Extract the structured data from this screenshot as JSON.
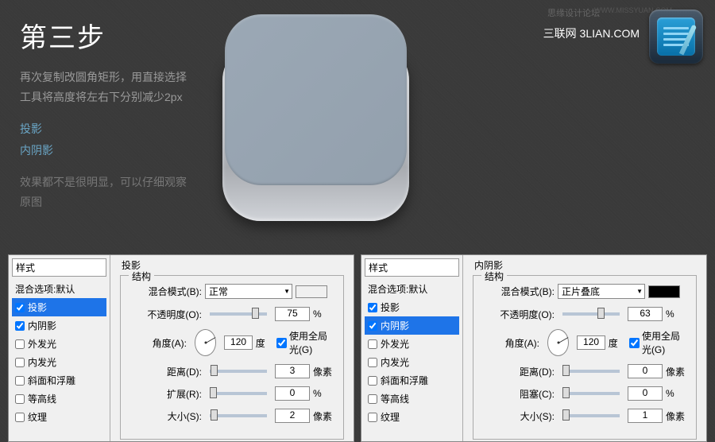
{
  "watermarks": {
    "forum": "思缘设计论坛",
    "url": "WWW.MISSYUAN.COM"
  },
  "brand": "三联网 3LIAN.COM",
  "tutorial": {
    "title": "第三步",
    "description": "再次复制改圆角矩形，用直接选择工具将高度将左右下分别减少2px",
    "links": {
      "drop_shadow": "投影",
      "inner_shadow": "内阴影"
    },
    "note": "效果都不是很明显，可以仔细观察原图"
  },
  "panel_left": {
    "title": "投影",
    "styles_header": "样式",
    "styles": [
      {
        "label": "混合选项:默认",
        "checkbox": false,
        "checked": false
      },
      {
        "label": "投影",
        "checkbox": true,
        "checked": true,
        "selected": true
      },
      {
        "label": "内阴影",
        "checkbox": true,
        "checked": true
      },
      {
        "label": "外发光",
        "checkbox": true,
        "checked": false
      },
      {
        "label": "内发光",
        "checkbox": true,
        "checked": false
      },
      {
        "label": "斜面和浮雕",
        "checkbox": true,
        "checked": false
      },
      {
        "label": "等高线",
        "checkbox": true,
        "checked": false
      },
      {
        "label": "纹理",
        "checkbox": true,
        "checked": false
      }
    ],
    "structure_label": "结构",
    "blend_mode": {
      "label": "混合模式(B):",
      "value": "正常",
      "swatch": "#ffffff"
    },
    "opacity": {
      "label": "不透明度(O):",
      "value": "75",
      "unit": "%"
    },
    "angle": {
      "label": "角度(A):",
      "value": "120",
      "unit": "度",
      "global": "使用全局光(G)",
      "global_checked": true
    },
    "distance": {
      "label": "距离(D):",
      "value": "3",
      "unit": "像素"
    },
    "spread": {
      "label": "扩展(R):",
      "value": "0",
      "unit": "%"
    },
    "size": {
      "label": "大小(S):",
      "value": "2",
      "unit": "像素"
    }
  },
  "panel_right": {
    "title": "内阴影",
    "styles_header": "样式",
    "styles": [
      {
        "label": "混合选项:默认",
        "checkbox": false,
        "checked": false
      },
      {
        "label": "投影",
        "checkbox": true,
        "checked": true
      },
      {
        "label": "内阴影",
        "checkbox": true,
        "checked": true,
        "selected": true
      },
      {
        "label": "外发光",
        "checkbox": true,
        "checked": false
      },
      {
        "label": "内发光",
        "checkbox": true,
        "checked": false
      },
      {
        "label": "斜面和浮雕",
        "checkbox": true,
        "checked": false
      },
      {
        "label": "等高线",
        "checkbox": true,
        "checked": false
      },
      {
        "label": "纹理",
        "checkbox": true,
        "checked": false
      }
    ],
    "structure_label": "结构",
    "blend_mode": {
      "label": "混合模式(B):",
      "value": "正片叠底",
      "swatch": "#000000"
    },
    "opacity": {
      "label": "不透明度(O):",
      "value": "63",
      "unit": "%"
    },
    "angle": {
      "label": "角度(A):",
      "value": "120",
      "unit": "度",
      "global": "使用全局光(G)",
      "global_checked": true
    },
    "distance": {
      "label": "距离(D):",
      "value": "0",
      "unit": "像素"
    },
    "choke": {
      "label": "阻塞(C):",
      "value": "0",
      "unit": "%"
    },
    "size": {
      "label": "大小(S):",
      "value": "1",
      "unit": "像素"
    }
  }
}
